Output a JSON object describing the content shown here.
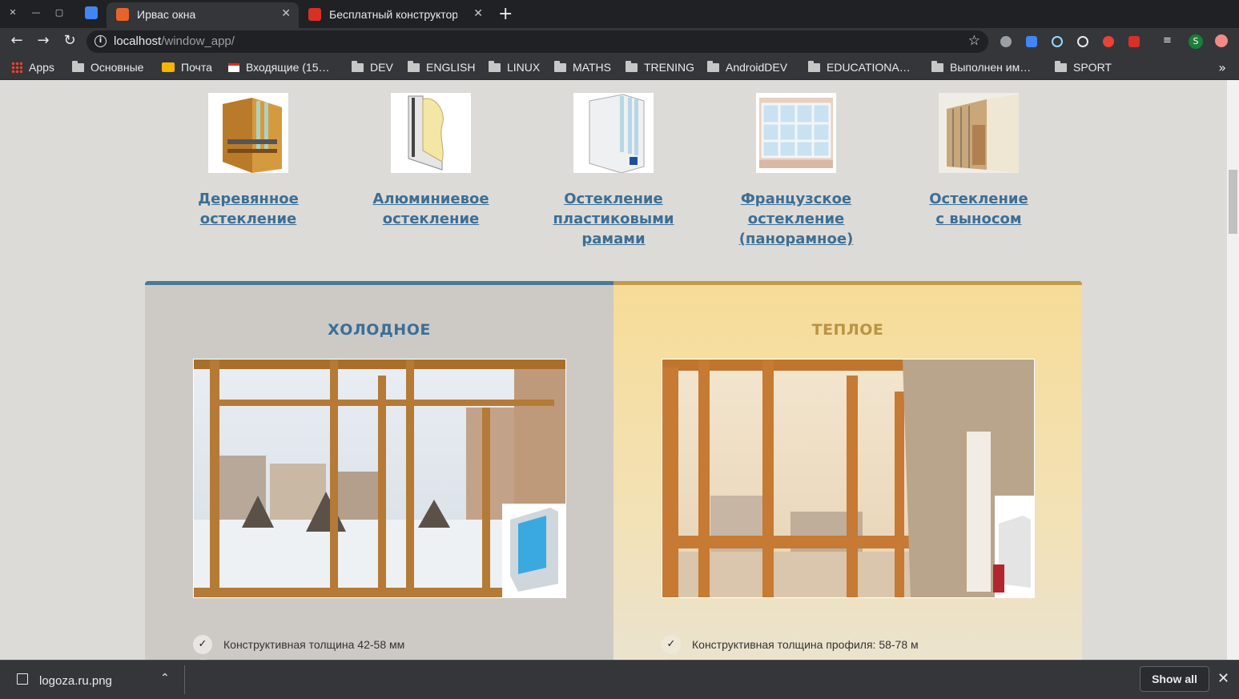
{
  "browser": {
    "tabs": [
      {
        "title": "Ирвас окна",
        "active": true,
        "favicon_color": "#e8632b"
      },
      {
        "title": "Бесплатный конструктор",
        "active": false,
        "favicon_color": "#d93025"
      }
    ],
    "url_host": "localhost",
    "url_path": "/window_app/",
    "bookmarks": [
      {
        "label": "Apps",
        "icon": "apps-grid-icon"
      },
      {
        "label": "Основные",
        "icon": "folder-icon"
      },
      {
        "label": "Почта",
        "icon": "mail-icon"
      },
      {
        "label": "Входящие (15…",
        "icon": "gmail-icon"
      },
      {
        "label": "DEV",
        "icon": "folder-icon"
      },
      {
        "label": "ENGLISH",
        "icon": "folder-icon"
      },
      {
        "label": "LINUX",
        "icon": "folder-icon"
      },
      {
        "label": "MATHS",
        "icon": "folder-icon"
      },
      {
        "label": "TRENING",
        "icon": "folder-icon"
      },
      {
        "label": "AndroidDEV",
        "icon": "folder-icon"
      },
      {
        "label": "EDUCATIONA…",
        "icon": "folder-icon"
      },
      {
        "label": "Выполнен им…",
        "icon": "folder-icon"
      },
      {
        "label": "SPORT",
        "icon": "folder-icon"
      }
    ],
    "profile_initial": "S"
  },
  "glazing_types": [
    {
      "line1": "Деревянное",
      "line2": "остекление",
      "line3": ""
    },
    {
      "line1": "Алюминиевое",
      "line2": "остекление",
      "line3": ""
    },
    {
      "line1": "Остекление",
      "line2": "пластиковыми",
      "line3": "рамами"
    },
    {
      "line1": "Французское",
      "line2": "остекление",
      "line3": "(панорамное)"
    },
    {
      "line1": "Остекление",
      "line2": "с выносом",
      "line3": ""
    }
  ],
  "compare": {
    "cold": {
      "title": "ХОЛОДНОЕ",
      "feature1": "Конструктивная толщина 42-58 мм",
      "accent": "#4a7a96"
    },
    "warm": {
      "title": "ТЕПЛОЕ",
      "feature1": "Конструктивная толщина профиля: 58-78 м",
      "accent": "#c49a4a"
    }
  },
  "download_shelf": {
    "filename": "logoza.ru.png",
    "show_all": "Show all"
  }
}
